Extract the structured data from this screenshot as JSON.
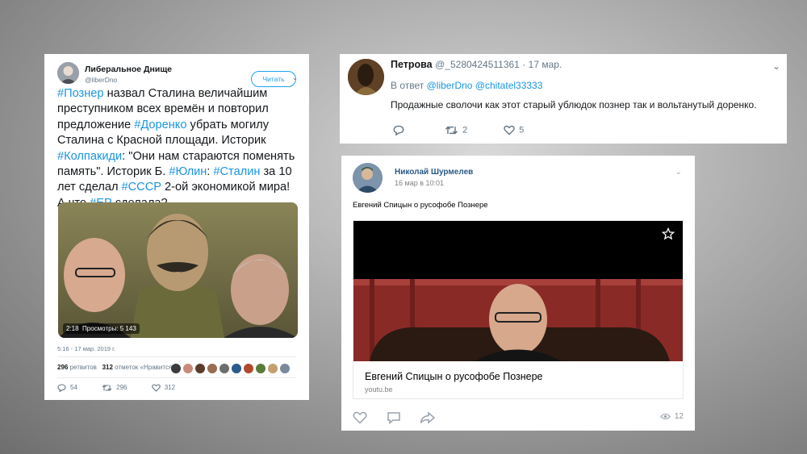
{
  "tweet1": {
    "author_name": "Либеральное Днище",
    "author_handle": "@liberDno",
    "follow_label": "Читать",
    "text_segments": [
      {
        "t": "#Познер",
        "tag": true
      },
      {
        "t": " назвал Сталина величайшим преступником всех времён и повторил предложение ",
        "tag": false
      },
      {
        "t": "#Доренко",
        "tag": true
      },
      {
        "t": " убрать могилу Сталина с Красной площади. Историк ",
        "tag": false
      },
      {
        "t": "#Колпакиди",
        "tag": true
      },
      {
        "t": ": \"Они нам стараются поменять память\". Историк Б. ",
        "tag": false
      },
      {
        "t": "#Юлин",
        "tag": true
      },
      {
        "t": ": ",
        "tag": false
      },
      {
        "t": "#Сталин",
        "tag": true
      },
      {
        "t": " за 10 лет сделал ",
        "tag": false
      },
      {
        "t": "#СССР",
        "tag": true
      },
      {
        "t": " 2-ой экономикой мира! А что ",
        "tag": false
      },
      {
        "t": "#ЕР",
        "tag": true
      },
      {
        "t": " сделала?",
        "tag": false
      }
    ],
    "video_duration": "2:18",
    "video_views": "Просмотры: 5 143",
    "timestamp": "5:16 - 17 мар. 2019 г.",
    "retweets_count": "296",
    "retweets_label": "ретвитов",
    "likes_count": "312",
    "likes_label": "отметок «Нравится»",
    "action_replies": "54",
    "action_retweets": "296",
    "action_likes": "312",
    "liker_colors": [
      "#3a3a3a",
      "#c98b7a",
      "#5b3b2a",
      "#9a6e52",
      "#6d6d6d",
      "#2c5a8a",
      "#b04a2a",
      "#5a7a3a",
      "#c4a070",
      "#7a8a9a"
    ],
    "accent": "#1da1f2"
  },
  "tweet2": {
    "author_name": "Петрова",
    "author_handle": "@_5280424511361",
    "date": "· 17 мар.",
    "reply_prefix": "В ответ",
    "reply_to_1": "@liberDno",
    "reply_to_2": "@chitatel33333",
    "body": "Продажные сволочи как этот старый ублюдок познер так и вольтанутый доренко.",
    "retweets": "2",
    "likes": "5"
  },
  "vk": {
    "author_name": "Николай Шурмелев",
    "date": "16 мар в 10:01",
    "post_text": "Евгений Спицын о русофобе Познере",
    "link_title": "Евгений Спицын о русофобе Познере",
    "link_domain": "youtu.be",
    "views": "12",
    "accent": "#2a5885"
  }
}
